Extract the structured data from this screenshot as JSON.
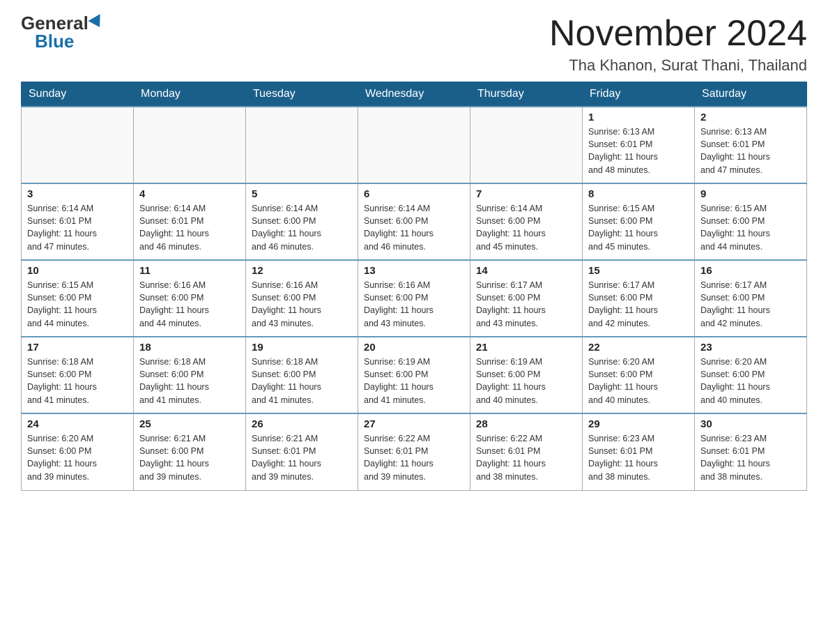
{
  "header": {
    "logo_general": "General",
    "logo_blue": "Blue",
    "title": "November 2024",
    "subtitle": "Tha Khanon, Surat Thani, Thailand"
  },
  "days_of_week": [
    "Sunday",
    "Monday",
    "Tuesday",
    "Wednesday",
    "Thursday",
    "Friday",
    "Saturday"
  ],
  "weeks": [
    [
      {
        "day": "",
        "info": ""
      },
      {
        "day": "",
        "info": ""
      },
      {
        "day": "",
        "info": ""
      },
      {
        "day": "",
        "info": ""
      },
      {
        "day": "",
        "info": ""
      },
      {
        "day": "1",
        "info": "Sunrise: 6:13 AM\nSunset: 6:01 PM\nDaylight: 11 hours\nand 48 minutes."
      },
      {
        "day": "2",
        "info": "Sunrise: 6:13 AM\nSunset: 6:01 PM\nDaylight: 11 hours\nand 47 minutes."
      }
    ],
    [
      {
        "day": "3",
        "info": "Sunrise: 6:14 AM\nSunset: 6:01 PM\nDaylight: 11 hours\nand 47 minutes."
      },
      {
        "day": "4",
        "info": "Sunrise: 6:14 AM\nSunset: 6:01 PM\nDaylight: 11 hours\nand 46 minutes."
      },
      {
        "day": "5",
        "info": "Sunrise: 6:14 AM\nSunset: 6:00 PM\nDaylight: 11 hours\nand 46 minutes."
      },
      {
        "day": "6",
        "info": "Sunrise: 6:14 AM\nSunset: 6:00 PM\nDaylight: 11 hours\nand 46 minutes."
      },
      {
        "day": "7",
        "info": "Sunrise: 6:14 AM\nSunset: 6:00 PM\nDaylight: 11 hours\nand 45 minutes."
      },
      {
        "day": "8",
        "info": "Sunrise: 6:15 AM\nSunset: 6:00 PM\nDaylight: 11 hours\nand 45 minutes."
      },
      {
        "day": "9",
        "info": "Sunrise: 6:15 AM\nSunset: 6:00 PM\nDaylight: 11 hours\nand 44 minutes."
      }
    ],
    [
      {
        "day": "10",
        "info": "Sunrise: 6:15 AM\nSunset: 6:00 PM\nDaylight: 11 hours\nand 44 minutes."
      },
      {
        "day": "11",
        "info": "Sunrise: 6:16 AM\nSunset: 6:00 PM\nDaylight: 11 hours\nand 44 minutes."
      },
      {
        "day": "12",
        "info": "Sunrise: 6:16 AM\nSunset: 6:00 PM\nDaylight: 11 hours\nand 43 minutes."
      },
      {
        "day": "13",
        "info": "Sunrise: 6:16 AM\nSunset: 6:00 PM\nDaylight: 11 hours\nand 43 minutes."
      },
      {
        "day": "14",
        "info": "Sunrise: 6:17 AM\nSunset: 6:00 PM\nDaylight: 11 hours\nand 43 minutes."
      },
      {
        "day": "15",
        "info": "Sunrise: 6:17 AM\nSunset: 6:00 PM\nDaylight: 11 hours\nand 42 minutes."
      },
      {
        "day": "16",
        "info": "Sunrise: 6:17 AM\nSunset: 6:00 PM\nDaylight: 11 hours\nand 42 minutes."
      }
    ],
    [
      {
        "day": "17",
        "info": "Sunrise: 6:18 AM\nSunset: 6:00 PM\nDaylight: 11 hours\nand 41 minutes."
      },
      {
        "day": "18",
        "info": "Sunrise: 6:18 AM\nSunset: 6:00 PM\nDaylight: 11 hours\nand 41 minutes."
      },
      {
        "day": "19",
        "info": "Sunrise: 6:18 AM\nSunset: 6:00 PM\nDaylight: 11 hours\nand 41 minutes."
      },
      {
        "day": "20",
        "info": "Sunrise: 6:19 AM\nSunset: 6:00 PM\nDaylight: 11 hours\nand 41 minutes."
      },
      {
        "day": "21",
        "info": "Sunrise: 6:19 AM\nSunset: 6:00 PM\nDaylight: 11 hours\nand 40 minutes."
      },
      {
        "day": "22",
        "info": "Sunrise: 6:20 AM\nSunset: 6:00 PM\nDaylight: 11 hours\nand 40 minutes."
      },
      {
        "day": "23",
        "info": "Sunrise: 6:20 AM\nSunset: 6:00 PM\nDaylight: 11 hours\nand 40 minutes."
      }
    ],
    [
      {
        "day": "24",
        "info": "Sunrise: 6:20 AM\nSunset: 6:00 PM\nDaylight: 11 hours\nand 39 minutes."
      },
      {
        "day": "25",
        "info": "Sunrise: 6:21 AM\nSunset: 6:00 PM\nDaylight: 11 hours\nand 39 minutes."
      },
      {
        "day": "26",
        "info": "Sunrise: 6:21 AM\nSunset: 6:01 PM\nDaylight: 11 hours\nand 39 minutes."
      },
      {
        "day": "27",
        "info": "Sunrise: 6:22 AM\nSunset: 6:01 PM\nDaylight: 11 hours\nand 39 minutes."
      },
      {
        "day": "28",
        "info": "Sunrise: 6:22 AM\nSunset: 6:01 PM\nDaylight: 11 hours\nand 38 minutes."
      },
      {
        "day": "29",
        "info": "Sunrise: 6:23 AM\nSunset: 6:01 PM\nDaylight: 11 hours\nand 38 minutes."
      },
      {
        "day": "30",
        "info": "Sunrise: 6:23 AM\nSunset: 6:01 PM\nDaylight: 11 hours\nand 38 minutes."
      }
    ]
  ]
}
